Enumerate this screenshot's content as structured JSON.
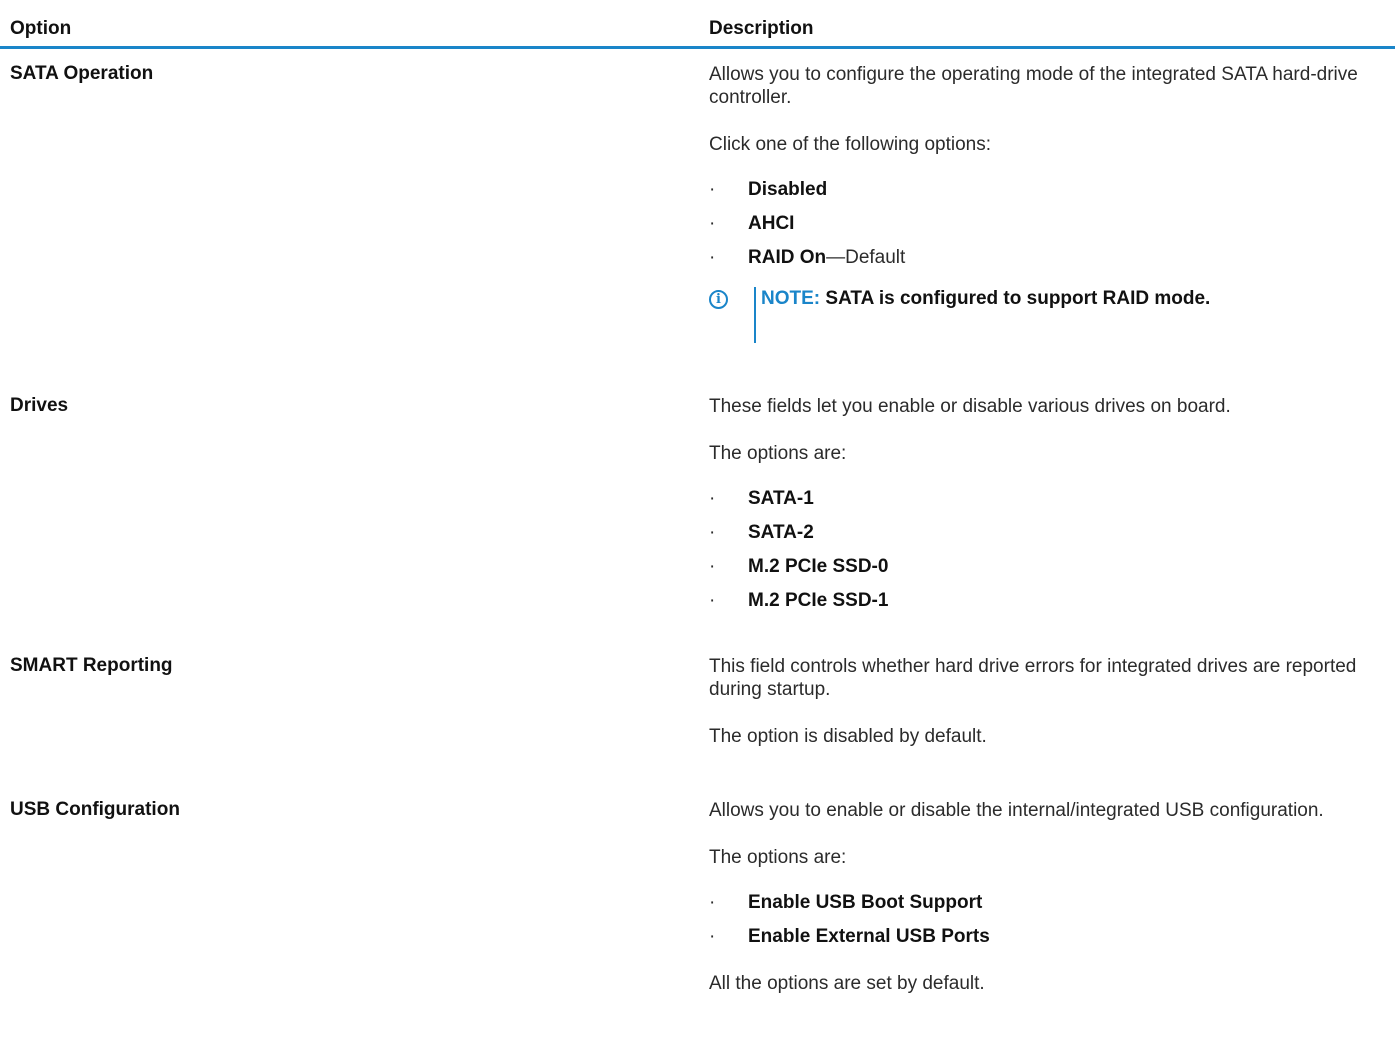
{
  "header": {
    "option": "Option",
    "description": "Description"
  },
  "rows": [
    {
      "name": "SATA Operation",
      "paragraph1": "Allows you to configure the operating mode of the integrated SATA hard-drive controller.",
      "paragraph2": "Click one of the following options:",
      "options": [
        {
          "label": "Disabled",
          "suffix": ""
        },
        {
          "label": "AHCI",
          "suffix": ""
        },
        {
          "label": "RAID On",
          "suffix": "—Default"
        }
      ],
      "note": {
        "label": "NOTE:",
        "text": "SATA is configured to support RAID mode."
      }
    },
    {
      "name": "Drives",
      "paragraph1": "These fields let you enable or disable various drives on board.",
      "paragraph2": "The options are:",
      "options": [
        {
          "label": "SATA-1"
        },
        {
          "label": "SATA-2"
        },
        {
          "label": "M.2 PCIe SSD-0"
        },
        {
          "label": "M.2 PCIe SSD-1"
        }
      ]
    },
    {
      "name": "SMART Reporting",
      "paragraph1": "This field controls whether hard drive errors for integrated drives are reported during startup.",
      "paragraph2": "The option is disabled by default."
    },
    {
      "name": "USB Configuration",
      "paragraph1": "Allows you to enable or disable the internal/integrated USB configuration.",
      "paragraph2": "The options are:",
      "options": [
        {
          "label": "Enable USB Boot Support"
        },
        {
          "label": "Enable External USB Ports"
        }
      ],
      "paragraph3": "All the options are set by default."
    }
  ],
  "bullet_char": "·",
  "icons": {
    "note": "info-icon"
  },
  "colors": {
    "accent": "#1a85c9"
  }
}
